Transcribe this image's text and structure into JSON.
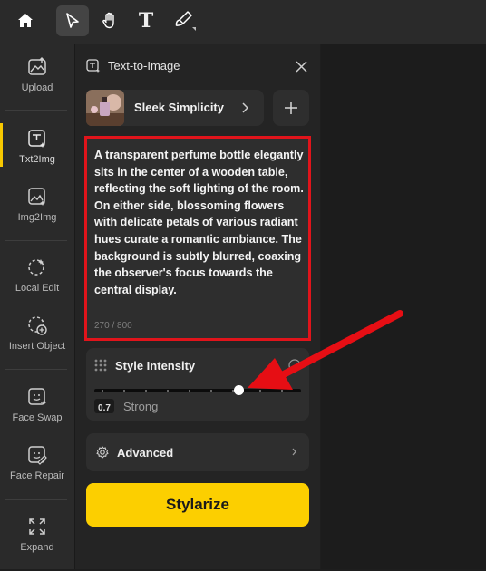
{
  "toolbar": {
    "home_icon": "home-icon",
    "tools": [
      "select-pointer-icon",
      "hand-icon",
      "text-icon",
      "brush-icon"
    ],
    "text_tool_label": "T"
  },
  "sidebar": {
    "items": [
      {
        "label": "Upload",
        "icon": "upload-icon"
      },
      {
        "label": "Txt2Img",
        "icon": "txt2img-icon",
        "active": true
      },
      {
        "label": "Img2Img",
        "icon": "img2img-icon"
      },
      {
        "label": "Local Edit",
        "icon": "local-edit-icon"
      },
      {
        "label": "Insert Object",
        "icon": "insert-object-icon"
      },
      {
        "label": "Face Swap",
        "icon": "face-swap-icon"
      },
      {
        "label": "Face Repair",
        "icon": "face-repair-icon"
      },
      {
        "label": "Expand",
        "icon": "expand-icon"
      }
    ],
    "accent_color": "#f7c800"
  },
  "panel": {
    "title": "Text-to-Image",
    "style_preset": "Sleek Simplicity",
    "prompt": "A transparent perfume bottle elegantly sits in the center of a wooden table, reflecting the soft lighting of the room. On either side, blossoming flowers with delicate petals of various radiant hues curate a romantic ambiance. The background is subtly blurred, coaxing the observer's focus towards the central display.",
    "prompt_count": "270 / 800",
    "style_intensity": {
      "label": "Style Intensity",
      "value": "0.7",
      "level": "Strong",
      "slider_fraction": 0.7
    },
    "advanced_label": "Advanced",
    "stylize_label": "Stylarize",
    "stylize_color": "#fccf00",
    "highlight_color": "#e0141b"
  }
}
